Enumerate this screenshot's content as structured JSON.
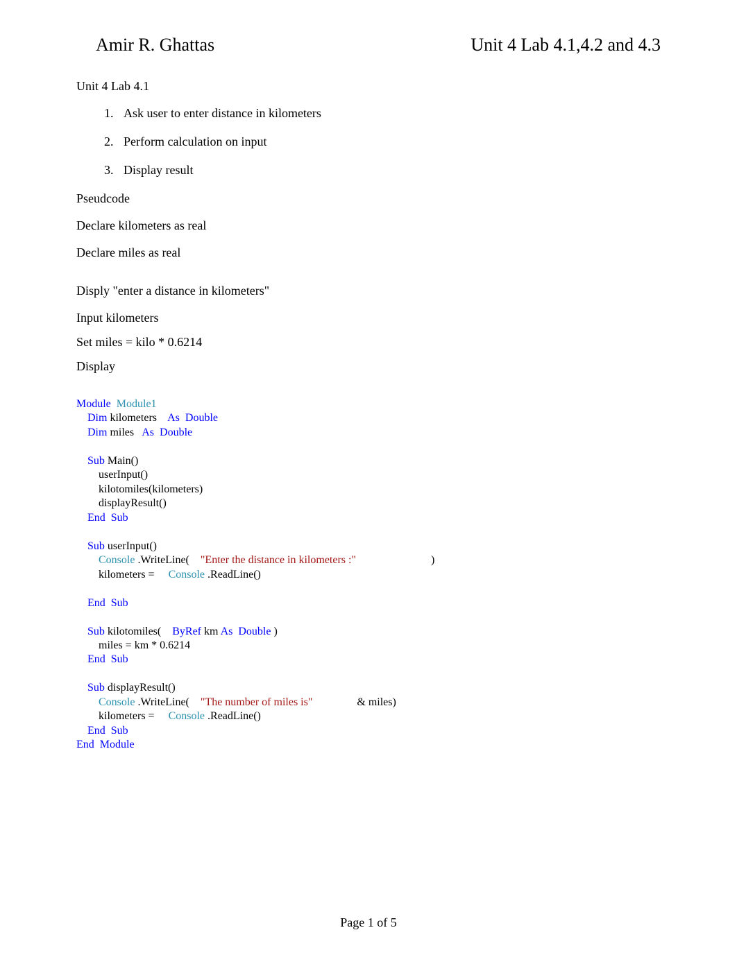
{
  "header": {
    "author": "Amir R. Ghattas",
    "title": "Unit 4 Lab 4.1,4.2 and 4.3"
  },
  "section1_title": "Unit 4 Lab 4.1",
  "steps": [
    "Ask user to enter distance in kilometers",
    "Perform calculation on input",
    "Display result"
  ],
  "pseudocode": {
    "heading": "Pseudcode",
    "lines": [
      "Declare kilometers as real",
      "Declare miles as real",
      "",
      "Disply \"enter a distance in kilometers\"",
      "Input kilometers",
      "Set miles = kilo * 0.6214",
      "Display"
    ]
  },
  "code": {
    "kw": {
      "module": "Module",
      "dim": "Dim",
      "as": "As",
      "double": "Double",
      "sub": "Sub",
      "end": "End",
      "byref": "ByRef"
    },
    "cls": {
      "module1": "Module1",
      "console": "Console"
    },
    "txt": {
      "kilometers_decl": " kilometers ",
      "miles_decl": " miles ",
      "main_sig": " Main()",
      "call_userInput": "        userInput()",
      "call_kilotomiles": "        kilotomiles(kilometers)",
      "call_displayResult": "        displayResult()",
      "userInput_sig": " userInput()",
      "writeLine_open": " .WriteLine( ",
      "writeLine_close_paren": " )",
      "kilometers_eq": "        kilometers = ",
      "readLine": " .ReadLine()",
      "kilotomiles_sig_open": " kilotomiles( ",
      "km_param_space": " km ",
      "paren_close_after_double": " )",
      "miles_assign": "        miles = km * 0.6214",
      "displayResult_sig": " displayResult()",
      "amp_miles": " & miles)"
    },
    "str": {
      "enter_dist": "\"Enter the distance in kilometers :\"",
      "num_miles": "\"The number of miles is\""
    }
  },
  "footer": "Page 1 of 5"
}
